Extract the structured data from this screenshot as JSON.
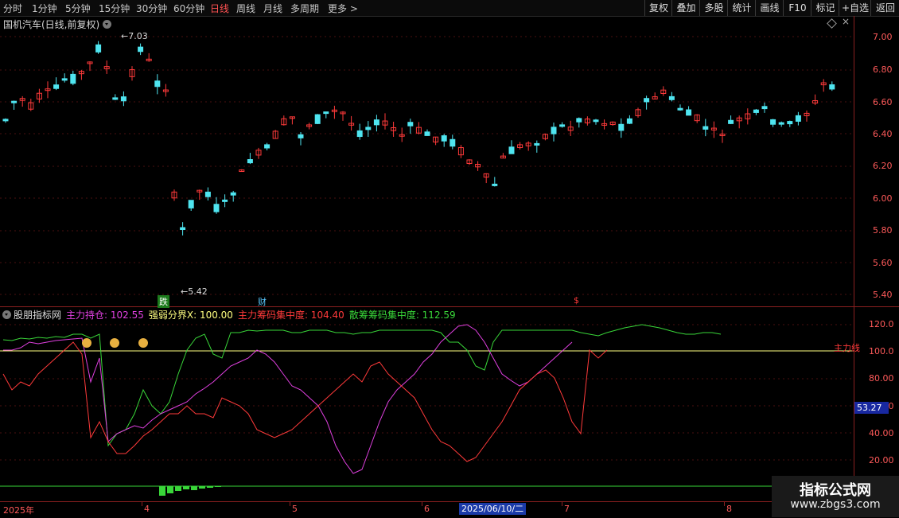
{
  "periods": [
    "分时",
    "1分钟",
    "5分钟",
    "15分钟",
    "30分钟",
    "60分钟",
    "日线",
    "周线",
    "月线",
    "多周期",
    "更多 >"
  ],
  "active_period": "日线",
  "toolbar": [
    "复权",
    "叠加",
    "多股",
    "统计",
    "画线",
    "F10",
    "标记",
    "+自选",
    "返回"
  ],
  "main": {
    "title": "国机汽车(日线,前复权)",
    "high_label": "7.03",
    "low_label": "5.42",
    "tags": {
      "die": "跌",
      "cai": "财",
      "dollar": "$"
    },
    "price_axis": [
      "7.00",
      "6.80",
      "6.60",
      "6.40",
      "6.20",
      "6.00",
      "5.80",
      "5.60",
      "5.40"
    ]
  },
  "indicator": {
    "name": "股朋指标网",
    "l1": "主力持仓: 102.55",
    "l2": "强弱分界X: 100.00",
    "l3": "主力筹码集中度: 104.40",
    "l4": "散筹筹码集中度: 112.59",
    "axis": [
      "120.0",
      "100.0",
      "80.00",
      "60.00",
      "40.00",
      "20.00"
    ],
    "current": "53.27",
    "line_label": "主力线"
  },
  "dates": {
    "year": "2025年",
    "m4": "4",
    "m5": "5",
    "m6": "6",
    "highlight": "2025/06/10/二",
    "m7": "7",
    "m8": "8"
  },
  "watermark": {
    "line1": "指标公式网",
    "line2": "www.zbgs3.com"
  },
  "colors": {
    "up": "#ff3a3a",
    "down": "#4fe5f0",
    "accent": "#ff5252",
    "green": "#39d639",
    "magenta": "#e040e0",
    "yellow": "#ffff80"
  }
}
